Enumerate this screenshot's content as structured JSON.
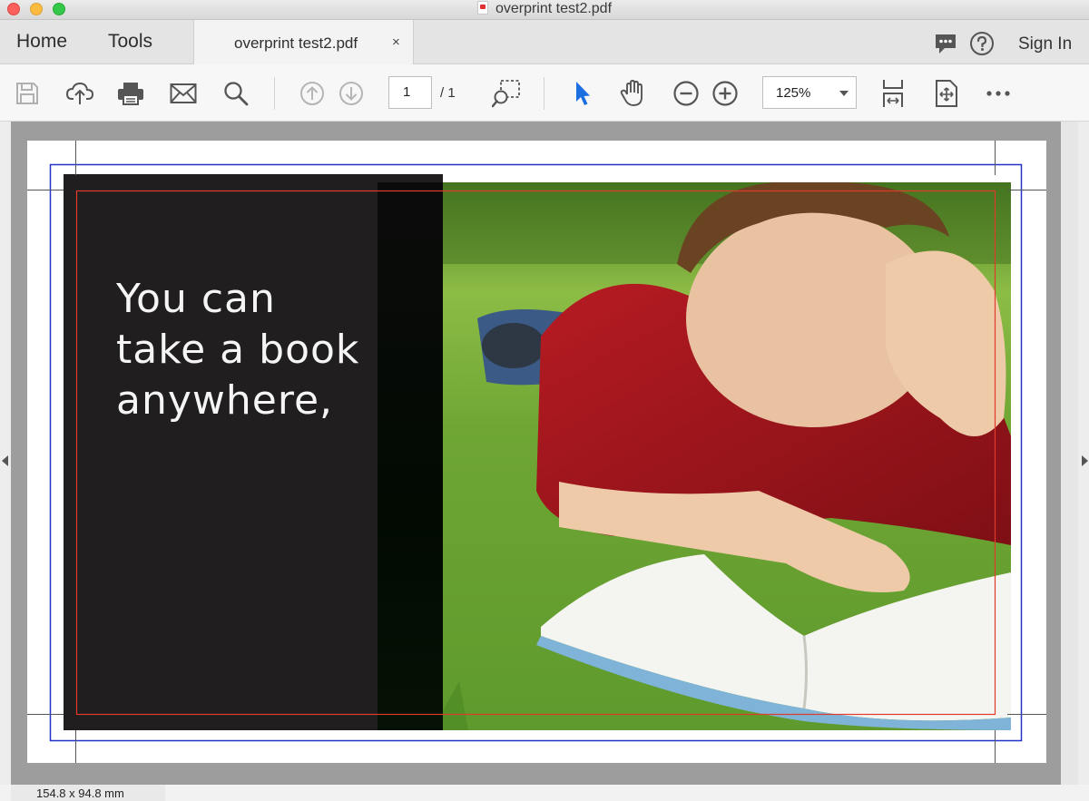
{
  "window": {
    "title": "overprint test2.pdf"
  },
  "tabs": {
    "home": "Home",
    "tools": "Tools",
    "document": {
      "label": "overprint test2.pdf",
      "close": "×"
    }
  },
  "header_right": {
    "sign_in": "Sign In",
    "icons": [
      "comment-icon",
      "help-icon"
    ]
  },
  "toolbar": {
    "icons": [
      "save-icon",
      "upload-icon",
      "print-icon",
      "email-icon",
      "search-icon",
      "page-up-icon",
      "page-down-icon",
      "marquee-zoom-icon",
      "select-arrow-icon",
      "hand-icon",
      "zoom-out-icon",
      "zoom-in-icon",
      "fit-page-icon",
      "scroll-mode-icon",
      "more-icon"
    ],
    "page_current": "1",
    "page_total": "/ 1",
    "zoom": "125%"
  },
  "document": {
    "headline": "You can\ntake a book\nanywhere,",
    "colors": {
      "dark_panel": "#201e1f",
      "trim_box": "#2233cc",
      "bleed_box": "#e03a2a",
      "accent_arrow": "#1c6fe0"
    }
  },
  "status": {
    "page_size": "154.8 x 94.8 mm"
  }
}
